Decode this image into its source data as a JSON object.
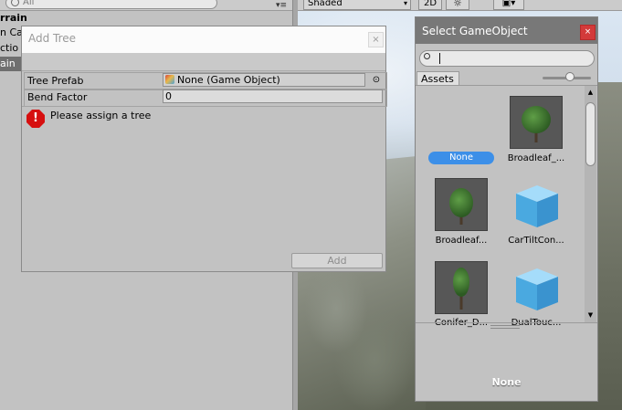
{
  "hierarchy": {
    "search_placeholder": "All",
    "menu_icon": "▾≡",
    "rows": [
      "rrain",
      "n Ca",
      "ctio",
      "ain"
    ]
  },
  "scene_toolbar": {
    "shading_mode": "Shaded",
    "mode_2d": "2D",
    "light_icon": "☼",
    "image_icon": "▣▾"
  },
  "add_tree": {
    "title": "Add Tree",
    "close": "×",
    "tree_prefab_label": "Tree Prefab",
    "tree_prefab_value": "None (Game Object)",
    "picker_icon": "⊙",
    "bend_factor_label": "Bend Factor",
    "bend_factor_value": "0",
    "warning": "Please assign a tree",
    "warning_icon": "!",
    "add_button": "Add"
  },
  "select_gameobject": {
    "title": "Select GameObject",
    "close": "×",
    "search_value": "",
    "tab": "Assets",
    "items": [
      {
        "label": "None",
        "icon": "none-pill"
      },
      {
        "label": "Broadleaf_...",
        "icon": "tree-icon"
      },
      {
        "label": "Broadleaf...",
        "icon": "tree-icon"
      },
      {
        "label": "CarTiltCon...",
        "icon": "cube-icon"
      },
      {
        "label": "Conifer_D...",
        "icon": "tree-icon"
      },
      {
        "label": "DualTouc...",
        "icon": "cube-icon"
      }
    ],
    "preview_name": "None",
    "scroll_up": "▲",
    "scroll_down": "▼"
  },
  "colors": {
    "accent_selected": "#3c8fe8",
    "close_button": "#d33a3a",
    "warning": "#d60f0f"
  }
}
